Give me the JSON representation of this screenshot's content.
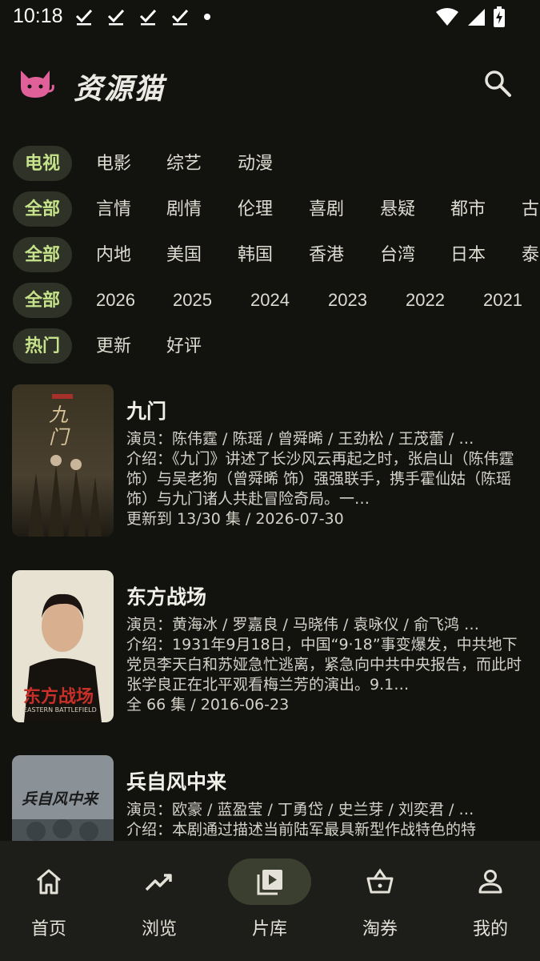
{
  "status_bar": {
    "time": "10:18"
  },
  "app": {
    "title": "资源猫"
  },
  "filters": {
    "type": [
      "电视",
      "电影",
      "综艺",
      "动漫"
    ],
    "genre": [
      "全部",
      "言情",
      "剧情",
      "伦理",
      "喜剧",
      "悬疑",
      "都市",
      "古"
    ],
    "region": [
      "全部",
      "内地",
      "美国",
      "韩国",
      "香港",
      "台湾",
      "日本",
      "泰"
    ],
    "year": [
      "全部",
      "2026",
      "2025",
      "2024",
      "2023",
      "2022",
      "2021"
    ],
    "sort": [
      "热门",
      "更新",
      "好评"
    ]
  },
  "items": [
    {
      "title": "九门",
      "cast": "演员：陈伟霆 / 陈瑶 / 曾舜晞 / 王劲松 / 王茂蕾 / …",
      "intro": "介绍：《九门》讲述了长沙风云再起之时，张启山（陈伟霆 饰）与吴老狗（曾舜晞 饰）强强联手，携手霍仙姑（陈瑶 饰）与九门诸人共赴冒险奇局。一…",
      "update": "更新到 13/30 集 / 2026-07-30",
      "poster_text": "九门"
    },
    {
      "title": "东方战场",
      "cast": "演员：黄海冰 / 罗嘉良 / 马晓伟 / 袁咏仪 / 俞飞鸿 …",
      "intro": "介绍：1931年9月18日，中国“9·18”事变爆发，中共地下党员李天白和苏娅急忙逃离，紧急向中共中央报告，而此时张学良正在北平观看梅兰芳的演出。9.1…",
      "update": "全 66 集 / 2016-06-23",
      "poster_text": "东方战场",
      "poster_subtext": "EASTERN BATTLEFIELD"
    },
    {
      "title": "兵自风中来",
      "cast": "演员：欧豪 / 蓝盈莹 / 丁勇岱 / 史兰芽 / 刘奕君 / …",
      "intro": "介绍：本剧通过描述当前陆军最具新型作战特色的特",
      "update": "",
      "poster_text": "兵自风中来"
    }
  ],
  "nav": [
    {
      "label": "首页",
      "icon": "home-icon"
    },
    {
      "label": "浏览",
      "icon": "trending-icon"
    },
    {
      "label": "片库",
      "icon": "library-icon",
      "active": true
    },
    {
      "label": "淘券",
      "icon": "basket-icon"
    },
    {
      "label": "我的",
      "icon": "person-icon"
    }
  ]
}
